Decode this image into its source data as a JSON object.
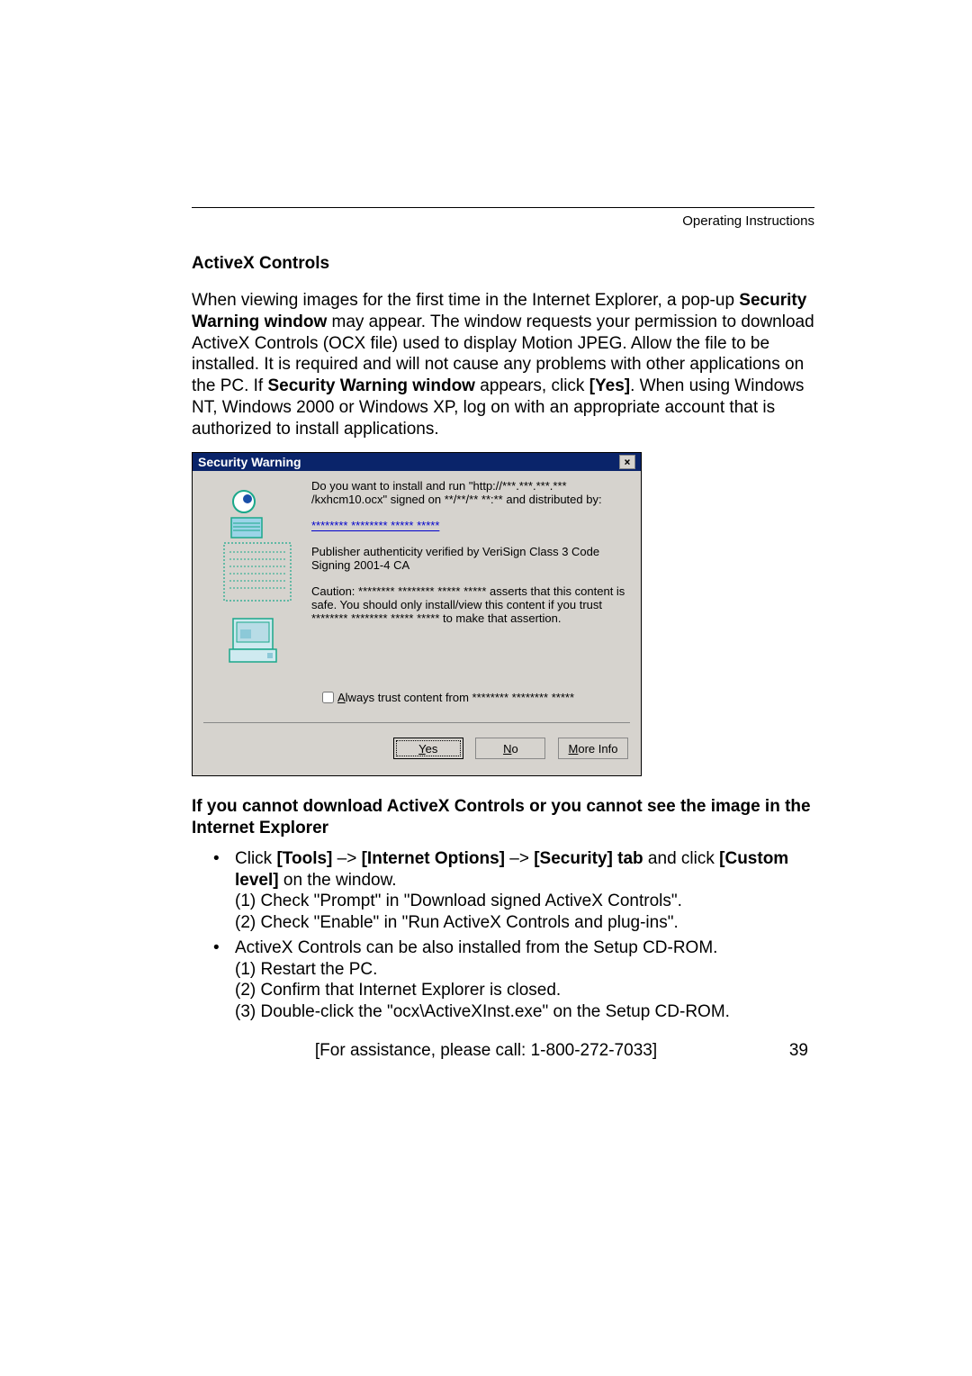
{
  "header": {
    "right": "Operating Instructions"
  },
  "section_title": "ActiveX Controls",
  "intro": {
    "p1a": "When viewing images for the first time in the Internet Explorer, a pop-up ",
    "p1b": "Security Warning window",
    "p1c": " may appear. The window requests your permission to download ActiveX Controls (OCX file) used to display Motion JPEG. Allow the file to be installed. It is required and will not cause any problems with other applications on the PC. If ",
    "p1d": "Security Warning window",
    "p1e": " appears, click ",
    "p1f": "[Yes]",
    "p1g": ". When using Windows NT, Windows 2000 or Windows XP, log on with an appropriate account that is authorized to install applications."
  },
  "dialog": {
    "title": "Security Warning",
    "line1": "Do you want to install and run \"http://***.***.***.*** /kxhcm10.ocx\" signed on **/**/** **:** and distributed by:",
    "link": "******** ******** ***** *****",
    "line2": "Publisher authenticity verified by VeriSign Class 3 Code Signing 2001-4 CA",
    "caution": "Caution: ******** ******** ***** ***** asserts that this content is safe. You should only install/view this content if you trust ******** ******** ***** ***** to make that assertion.",
    "always": "Always trust content from ******** ******** *****",
    "yes": "Yes",
    "no": "No",
    "more": "More Info"
  },
  "cannot": {
    "heading": "If you cannot download ActiveX Controls or you cannot see the image in the Internet Explorer",
    "b1_pre": "Click ",
    "b1_tools": "[Tools]",
    "b1_arrow1": " –> ",
    "b1_io": "[Internet Options]",
    "b1_arrow2": " –> ",
    "b1_sec": "[Security] tab",
    "b1_and": " and click ",
    "b1_custom": "[Custom level]",
    "b1_end": " on the window.",
    "b1_s1": "(1) Check \"Prompt\" in \"Download signed ActiveX Controls\".",
    "b1_s2": "(2) Check \"Enable\" in \"Run ActiveX Controls and plug-ins\".",
    "b2_main": "ActiveX Controls can be also installed from the Setup CD-ROM.",
    "b2_s1": "(1) Restart the PC.",
    "b2_s2": "(2) Confirm that Internet Explorer is closed.",
    "b2_s3": "(3) Double-click the \"ocx\\ActiveXInst.exe\" on the Setup CD-ROM."
  },
  "footer": {
    "assist": "[For assistance, please call: 1-800-272-7033]",
    "page": "39"
  }
}
